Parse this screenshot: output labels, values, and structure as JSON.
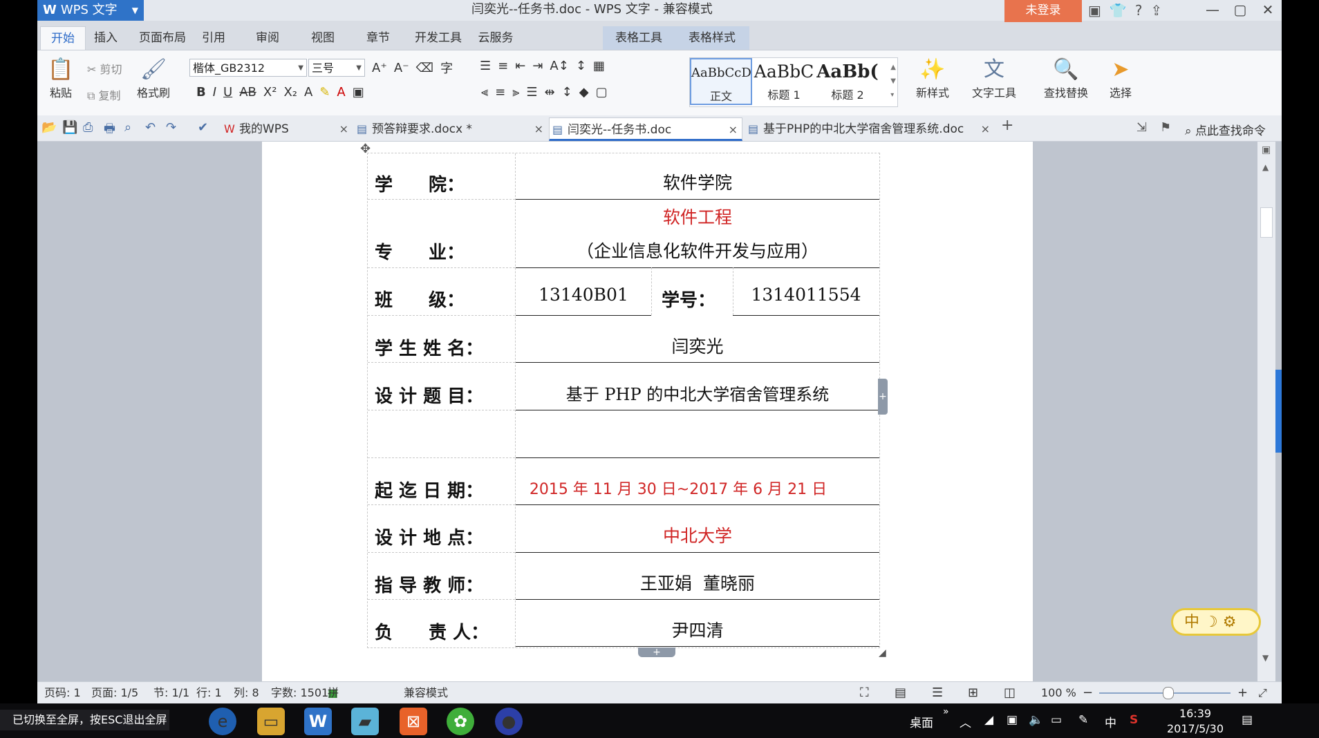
{
  "titlebar": {
    "app_menu": "WPS 文字",
    "logo": "W",
    "title": "闫奕光--任务书.doc - WPS 文字 - 兼容模式",
    "login": "未登录"
  },
  "menu_tabs": [
    "开始",
    "插入",
    "页面布局",
    "引用",
    "审阅",
    "视图",
    "章节",
    "开发工具",
    "云服务",
    "表格工具",
    "表格样式"
  ],
  "ribbon": {
    "paste": "粘贴",
    "cut": "剪切",
    "copy": "复制",
    "format_painter": "格式刷",
    "font_name": "楷体_GB2312",
    "font_size": "三号",
    "styles": [
      {
        "preview": "AaBbCcD",
        "name": "正文"
      },
      {
        "preview": "AaBbC",
        "name": "标题 1"
      },
      {
        "preview": "AaBb(",
        "name": "标题 2"
      }
    ],
    "new_style": "新样式",
    "text_tools": "文字工具",
    "find_replace": "查找替换",
    "select": "选择"
  },
  "doc_tabs": [
    {
      "label": "我的WPS"
    },
    {
      "label": "预答辩要求.docx *"
    },
    {
      "label": "闫奕光--任务书.doc"
    },
    {
      "label": "基于PHP的中北大学宿舍管理系统.doc"
    }
  ],
  "find_command": "点此查找命令",
  "form": {
    "college_label": "学　　院：",
    "college": "软件学院",
    "major_label": "专　　业：",
    "major_line1": "软件工程",
    "major_line2": "（企业信息化软件开发与应用）",
    "class_label": "班　　级：",
    "class_value": "13140B01",
    "student_no_label": "学号：",
    "student_no": "1314011554",
    "name_label": "学 生 姓 名：",
    "name": "闫奕光",
    "topic_label": "设 计 题 目：",
    "topic": "基于 PHP 的中北大学宿舍管理系统",
    "dates_label": "起 迄 日 期：",
    "dates": "2015 年 11 月 30 日~2017 年 6 月 21 日",
    "place_label": "设 计 地 点：",
    "place": "中北大学",
    "advisor_label": "指 导 教 师：",
    "advisor": "王亚娟  董晓丽",
    "owner_label": "负　　责 人：",
    "owner": "尹四清"
  },
  "ime": "中 ☽ ⚙",
  "status": {
    "page_code": "页码: 1",
    "page": "页面: 1/5",
    "section": "节: 1/1",
    "row": "行: 1",
    "col": "列: 8",
    "words": "字数: 1501",
    "spell": "拼写检查",
    "compat": "兼容模式",
    "zoom": "100 %"
  },
  "taskbar": {
    "toast": "已切换至全屏，按ESC退出全屏",
    "desktop": "桌面",
    "ime_indicator": "中",
    "time": "16:39",
    "date": "2017/5/30"
  },
  "colors": {
    "accent": "#2d6bc8",
    "login": "#e8734d",
    "red_text": "#d02525"
  }
}
